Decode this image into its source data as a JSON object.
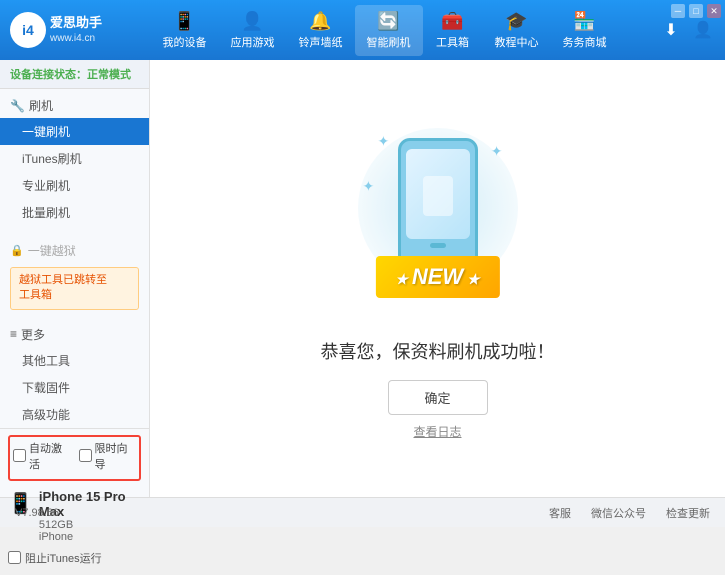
{
  "app": {
    "logo_text_line1": "爱思助手",
    "logo_text_line2": "www.i4.cn",
    "logo_symbol": "i4"
  },
  "nav": {
    "tabs": [
      {
        "id": "my-device",
        "icon": "📱",
        "label": "我的设备"
      },
      {
        "id": "app-game",
        "icon": "👤",
        "label": "应用游戏"
      },
      {
        "id": "ringtone",
        "icon": "🔔",
        "label": "铃声墙纸"
      },
      {
        "id": "smart-flash",
        "icon": "🔄",
        "label": "智能刷机",
        "active": true
      },
      {
        "id": "toolbox",
        "icon": "🧰",
        "label": "工具箱"
      },
      {
        "id": "tutorial",
        "icon": "🎓",
        "label": "教程中心"
      },
      {
        "id": "service",
        "icon": "🏪",
        "label": "务务商城"
      }
    ]
  },
  "sidebar": {
    "status_prefix": "设备连接状态：",
    "status_value": "正常模式",
    "section_flash": {
      "header_icon": "🔧",
      "header_label": "刷机",
      "items": [
        {
          "id": "one-key-flash",
          "label": "一键刷机",
          "active": true
        },
        {
          "id": "itunes-flash",
          "label": "iTunes刷机"
        },
        {
          "id": "pro-flash",
          "label": "专业刷机"
        },
        {
          "id": "batch-flash",
          "label": "批量刷机"
        }
      ]
    },
    "section_one_key_jailbreak": {
      "disabled_label": "一键越狱",
      "notice": "越狱工具已跳转至\n工具箱"
    },
    "section_more": {
      "header_label": "更多",
      "items": [
        {
          "id": "other-tools",
          "label": "其他工具"
        },
        {
          "id": "download-firmware",
          "label": "下载固件"
        },
        {
          "id": "advanced",
          "label": "高级功能"
        }
      ]
    },
    "auto_controls": {
      "auto_activate_label": "自动激活",
      "timing_guide_label": "限时向导"
    },
    "device": {
      "name": "iPhone 15 Pro Max",
      "storage": "512GB",
      "type": "iPhone"
    },
    "itunes_bar": {
      "label": "阻止iTunes运行"
    }
  },
  "content": {
    "success_text": "恭喜您，保资料刷机成功啦！",
    "confirm_button": "确定",
    "view_log_label": "查看日志"
  },
  "footer": {
    "version": "V7.98.66",
    "links": [
      "客服",
      "微信公众号",
      "检查更新"
    ]
  }
}
